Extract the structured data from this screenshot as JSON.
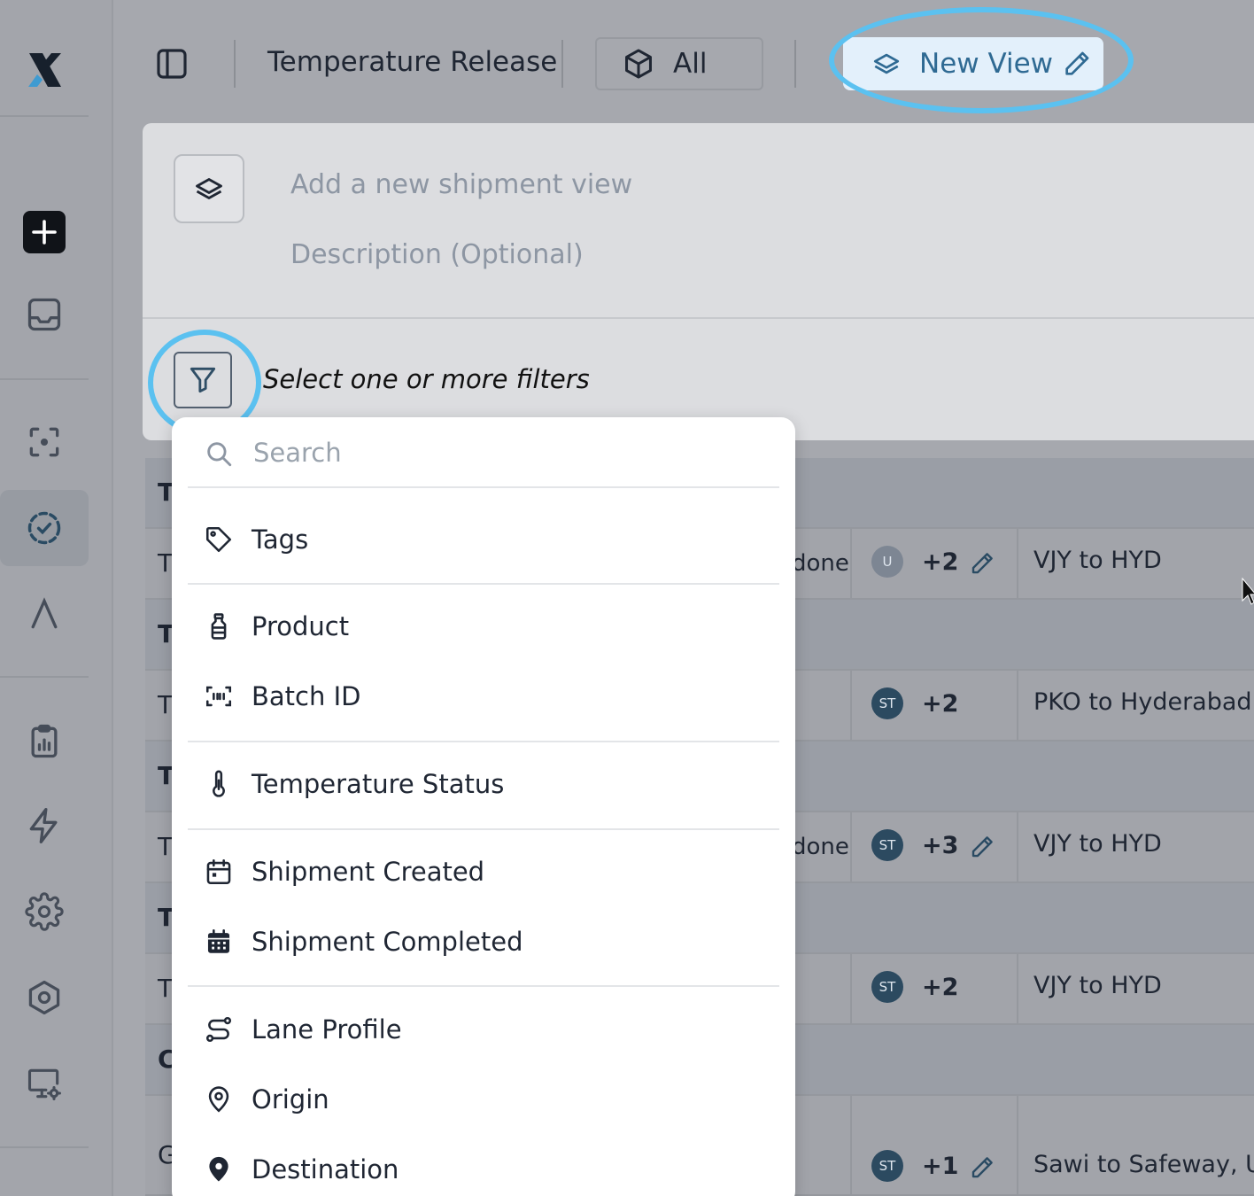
{
  "app": {
    "logo": "X",
    "accent_color": "#5bc1f0",
    "brand_color": "#2f6a93"
  },
  "sidebar": {
    "items": [
      {
        "icon": "add-icon"
      },
      {
        "icon": "inbox-icon"
      },
      {
        "icon": "scan-icon"
      },
      {
        "icon": "dashed-check-circle-icon",
        "active": true
      },
      {
        "icon": "lambda-icon"
      },
      {
        "icon": "clipboard-chart-icon"
      },
      {
        "icon": "lightning-icon"
      },
      {
        "icon": "gear-icon"
      },
      {
        "icon": "hexagon-settings-icon"
      },
      {
        "icon": "monitor-settings-icon"
      }
    ]
  },
  "topbar": {
    "title": "Temperature Release",
    "scope_label": "All",
    "new_view_label": "New View"
  },
  "view_panel": {
    "name_placeholder": "Add a new shipment view",
    "description_placeholder": "Description (Optional)",
    "filter_prompt": "Select one or more filters"
  },
  "table": {
    "rows": [
      {
        "type": "group",
        "first": "T"
      },
      {
        "type": "data",
        "first": "T",
        "status": "done",
        "avatar": "U",
        "more": "+2",
        "editable": true,
        "route": "VJY to HYD"
      },
      {
        "type": "group",
        "first": "T"
      },
      {
        "type": "data",
        "first": "T",
        "status": "",
        "avatar": "ST",
        "more": "+2",
        "editable": false,
        "route": "PKO to Hyderabad"
      },
      {
        "type": "group",
        "first": "T"
      },
      {
        "type": "data",
        "first": "T",
        "status": "done",
        "avatar": "ST",
        "more": "+3",
        "editable": true,
        "route": "VJY to HYD"
      },
      {
        "type": "group",
        "first": "T"
      },
      {
        "type": "data",
        "first": "T",
        "status": "",
        "avatar": "ST",
        "more": "+2",
        "editable": false,
        "route": "VJY to HYD"
      },
      {
        "type": "group",
        "first": "C"
      },
      {
        "type": "data",
        "first": "G",
        "status": "",
        "avatar": "ST",
        "more": "+1",
        "editable": true,
        "route": "Sawi to Safeway, USA"
      }
    ]
  },
  "filter_menu": {
    "search_placeholder": "Search",
    "items": [
      {
        "label": "Tags",
        "icon": "tag-icon"
      },
      {
        "label": "Product",
        "icon": "bottle-icon"
      },
      {
        "label": "Batch ID",
        "icon": "barcode-scan-icon"
      },
      {
        "label": "Temperature Status",
        "icon": "thermometer-icon"
      },
      {
        "label": "Shipment Created",
        "icon": "calendar-icon"
      },
      {
        "label": "Shipment Completed",
        "icon": "calendar-filled-icon"
      },
      {
        "label": "Lane Profile",
        "icon": "route-icon"
      },
      {
        "label": "Origin",
        "icon": "map-pin-outline-icon"
      },
      {
        "label": "Destination",
        "icon": "map-pin-filled-icon"
      }
    ]
  }
}
